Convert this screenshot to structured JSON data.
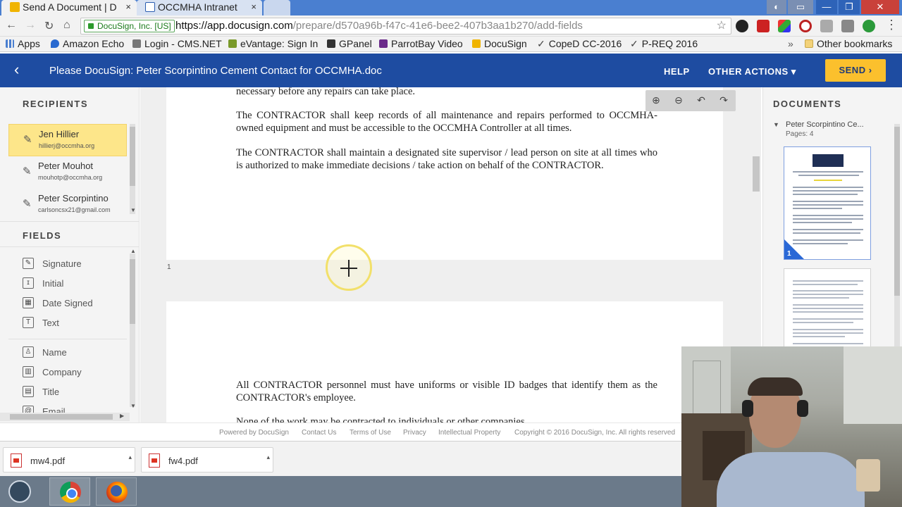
{
  "browser": {
    "tabs": [
      {
        "title": "Send A Document | D",
        "close": "×"
      },
      {
        "title": "OCCMHA Intranet",
        "close": "×"
      },
      {
        "title": ""
      }
    ],
    "security_label": "DocuSign, Inc. [US]",
    "url_host": "https://app.docusign.com",
    "url_path": "/prepare/d570a96b-f47c-41e6-bee2-407b3aa1b270/add-fields",
    "bookmarks": [
      "Apps",
      "Amazon Echo",
      "Login - CMS.NET",
      "eVantage: Sign In",
      "GPanel",
      "ParrotBay Video",
      "DocuSign",
      "CopeD CC-2016",
      "P-REQ 2016"
    ],
    "bookmarks_more": "»",
    "other_bookmarks": "Other bookmarks"
  },
  "header": {
    "back_glyph": "‹",
    "title": "Please DocuSign: Peter Scorpintino Cement Contact for OCCMHA.doc",
    "help": "HELP",
    "other_actions": "OTHER ACTIONS ▾",
    "send": "SEND ›"
  },
  "recipients": {
    "heading": "RECIPIENTS",
    "items": [
      {
        "name": "Jen Hillier",
        "email": "hillierj@occmha.org"
      },
      {
        "name": "Peter Mouhot",
        "email": "mouhotp@occmha.org"
      },
      {
        "name": "Peter Scorpintino",
        "email": "carlsoncsx21@gmail.com"
      }
    ]
  },
  "fields": {
    "heading": "FIELDS",
    "items": [
      {
        "label": "Signature",
        "icon": "signature-icon",
        "glyph": "✎"
      },
      {
        "label": "Initial",
        "icon": "initial-icon",
        "glyph": "ɪ"
      },
      {
        "label": "Date Signed",
        "icon": "calendar-icon",
        "glyph": "▦"
      },
      {
        "label": "Text",
        "icon": "text-icon",
        "glyph": "T"
      },
      {
        "label": "Name",
        "icon": "person-icon",
        "glyph": "♙"
      },
      {
        "label": "Company",
        "icon": "building-icon",
        "glyph": "▥"
      },
      {
        "label": "Title",
        "icon": "badge-icon",
        "glyph": "▤"
      },
      {
        "label": "Email",
        "icon": "at-icon",
        "glyph": "@"
      }
    ]
  },
  "document": {
    "page1_paragraphs": [
      "necessary before any repairs can take place.",
      "The CONTRACTOR shall keep records of all maintenance and repairs performed to OCCMHA-owned equipment and must be accessible to the OCCMHA Controller at all times.",
      "The CONTRACTOR shall maintain a designated site supervisor / lead person on site at all times who is authorized to make immediate decisions / take action on behalf of the CONTRACTOR."
    ],
    "page_number": "1",
    "page2_paragraphs": [
      "All CONTRACTOR personnel must have uniforms or visible ID badges that identify them as the CONTRACTOR's employee.",
      "None of the work may be contracted to individuals or other companies"
    ]
  },
  "documents_panel": {
    "heading": "DOCUMENTS",
    "doc_name": "Peter Scorpintino Ce...",
    "pages": "Pages: 4",
    "thumb_page": "1"
  },
  "footer": [
    "Powered by DocuSign",
    "Contact Us",
    "Terms of Use",
    "Privacy",
    "Intellectual Property",
    "Copyright © 2016 DocuSign, Inc. All rights reserved"
  ],
  "downloads": [
    {
      "name": "mw4.pdf"
    },
    {
      "name": "fw4.pdf"
    }
  ],
  "colors": {
    "docusign_blue": "#1e4ca1",
    "send_yellow": "#fbc02d",
    "selected_recipient": "#fde68a"
  }
}
